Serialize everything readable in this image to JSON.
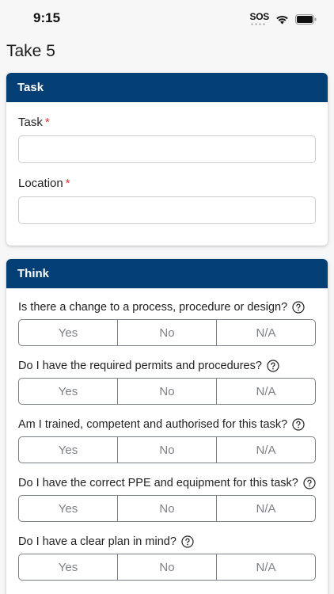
{
  "status_bar": {
    "time": "9:15",
    "sos": "SOS",
    "icons": [
      "sos-icon",
      "wifi-icon",
      "battery-icon"
    ]
  },
  "page": {
    "title": "Take 5"
  },
  "colors": {
    "header_bg": "#033e75",
    "required": "#dd3333"
  },
  "task_card": {
    "header": "Task",
    "required_marker": "*",
    "fields": [
      {
        "label": "Task",
        "value": "",
        "placeholder": ""
      },
      {
        "label": "Location",
        "value": "",
        "placeholder": ""
      }
    ]
  },
  "think_card": {
    "header": "Think",
    "options": [
      "Yes",
      "No",
      "N/A"
    ],
    "questions": [
      "Is there a change to a process, procedure or design?",
      "Do I have the required permits and procedures?",
      "Am I trained, competent and authorised for this task?",
      "Do I have the correct PPE and equipment for this task?",
      "Do I have a clear plan in mind?"
    ]
  }
}
